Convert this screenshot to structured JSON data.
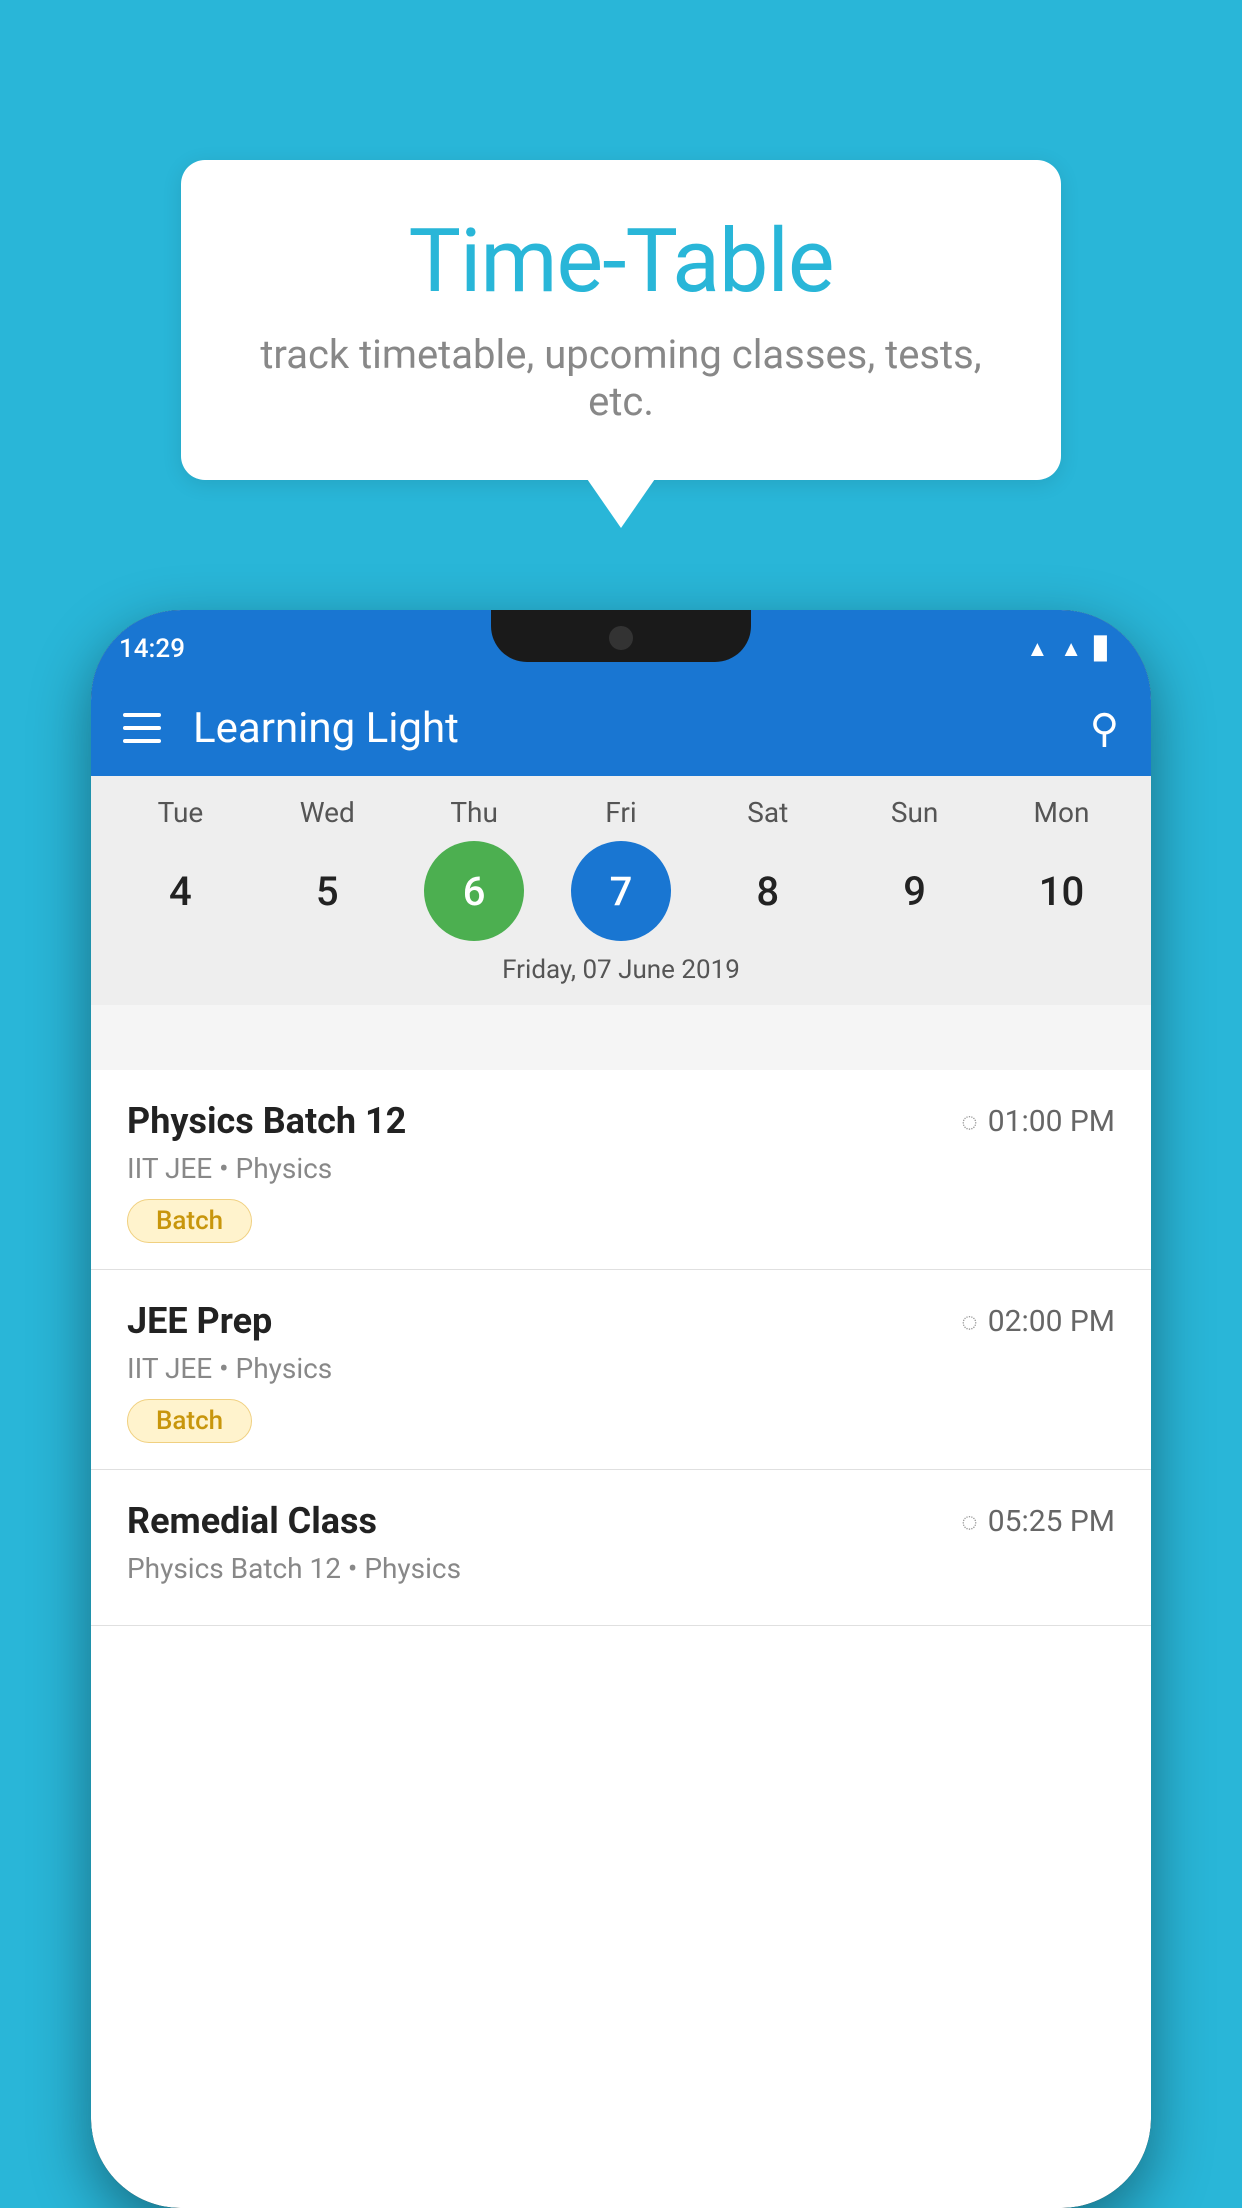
{
  "background": {
    "color": "#29b6d8"
  },
  "tooltip": {
    "title": "Time-Table",
    "subtitle": "track timetable, upcoming classes, tests, etc."
  },
  "app": {
    "app_name": "Learning Light",
    "status_time": "14:29",
    "menu_icon": "≡",
    "search_icon": "🔍"
  },
  "calendar": {
    "days": [
      "Tue",
      "Wed",
      "Thu",
      "Fri",
      "Sat",
      "Sun",
      "Mon"
    ],
    "dates": [
      "4",
      "5",
      "6",
      "7",
      "8",
      "9",
      "10"
    ],
    "today_index": 2,
    "selected_index": 3,
    "selected_label": "Friday, 07 June 2019"
  },
  "classes": [
    {
      "name": "Physics Batch 12",
      "time": "01:00 PM",
      "subtitle": "IIT JEE • Physics",
      "badge": "Batch"
    },
    {
      "name": "JEE Prep",
      "time": "02:00 PM",
      "subtitle": "IIT JEE • Physics",
      "badge": "Batch"
    },
    {
      "name": "Remedial Class",
      "time": "05:25 PM",
      "subtitle": "Physics Batch 12 • Physics",
      "badge": ""
    }
  ]
}
